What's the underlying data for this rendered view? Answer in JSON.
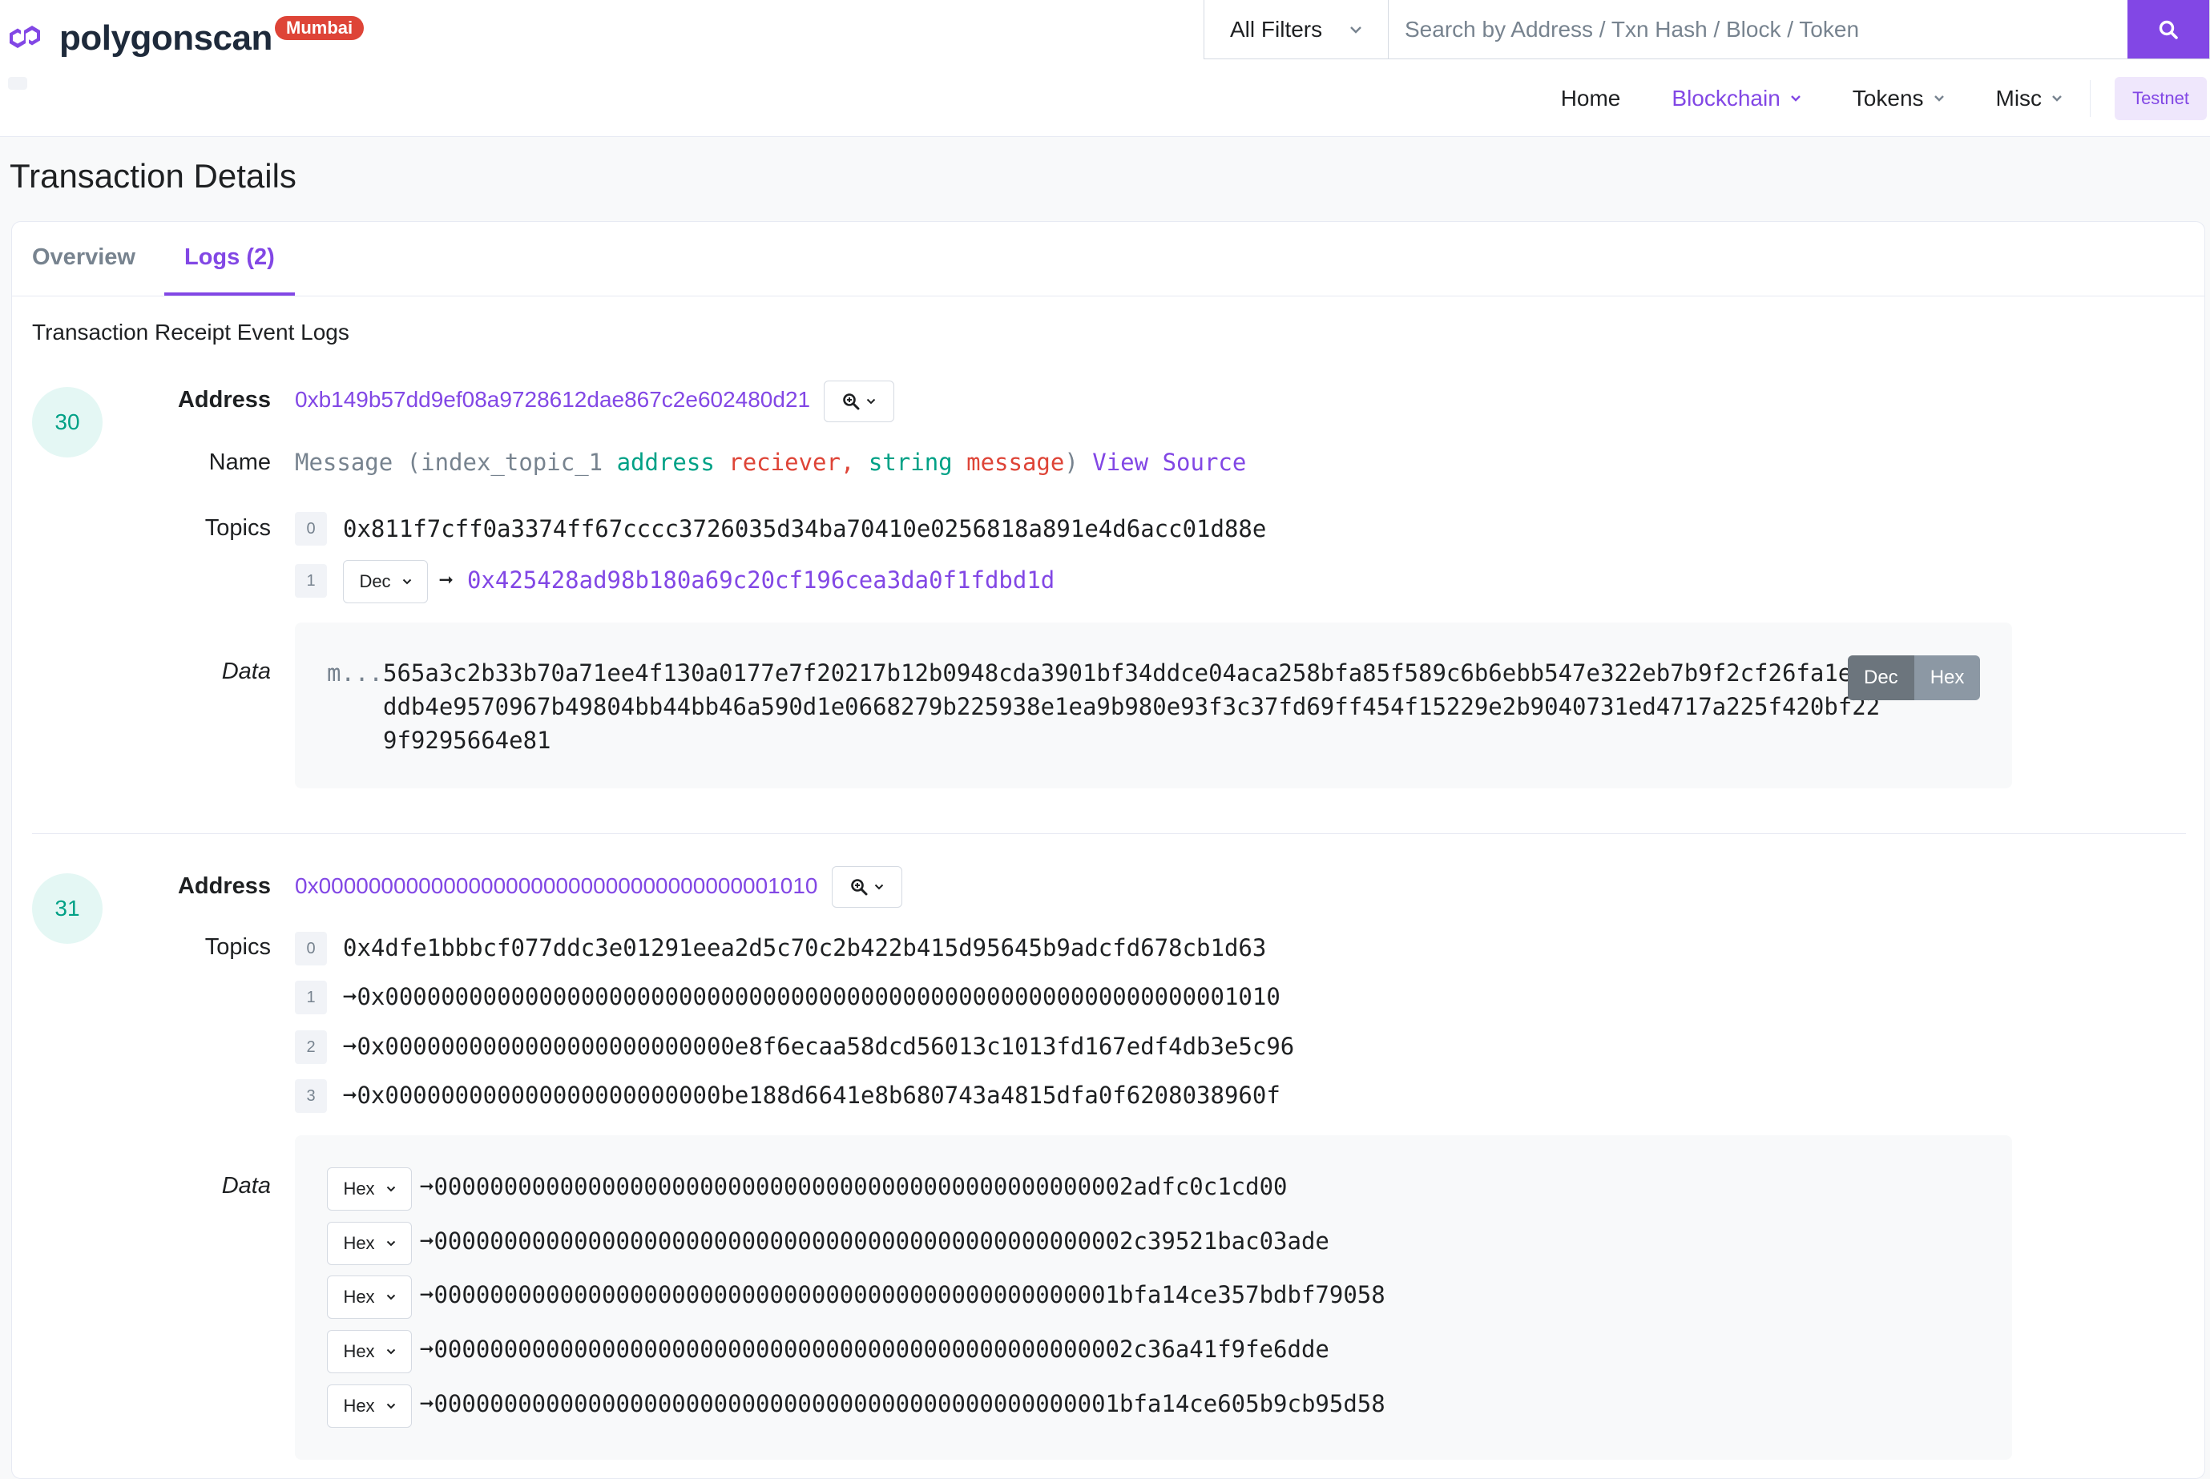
{
  "header": {
    "logo_text": "polygonscan",
    "network_badge": "Mumbai",
    "filter_label": "All Filters",
    "search_placeholder": "Search by Address / Txn Hash / Block / Token",
    "nav": [
      {
        "label": "Home"
      },
      {
        "label": "Blockchain"
      },
      {
        "label": "Tokens"
      },
      {
        "label": "Misc"
      }
    ],
    "testnet_label": "Testnet"
  },
  "page_title": "Transaction Details",
  "tabs": [
    {
      "label": "Overview"
    },
    {
      "label": "Logs (2)"
    }
  ],
  "section_title": "Transaction Receipt Event Logs",
  "labels": {
    "address": "Address",
    "name": "Name",
    "topics": "Topics",
    "data": "Data"
  },
  "logs": [
    {
      "index": "30",
      "address": "0xb149b57dd9ef08a9728612dae867c2e602480d21",
      "name": {
        "event": "Message (index_topic_1",
        "type1": "address",
        "param1": "reciever,",
        "type2": "string",
        "param2": "message",
        "close": ")",
        "view_source": "View Source"
      },
      "topics": [
        {
          "idx": "0",
          "value": "0x811f7cff0a3374ff67cccc3726035d34ba70410e0256818a891e4d6acc01d88e"
        },
        {
          "idx": "1",
          "format": "Dec",
          "value": "0x425428ad98b180a69c20cf196cea3da0f1fdbd1d"
        }
      ],
      "data_prefix": "m...",
      "data_lines": [
        "565a3c2b33b70a71ee4f130a0177e7f20217b12b0948cda3901bf34ddce04aca258bfa85f589c6b6ebb547e322eb7b9f2cf26fa1e32",
        "ddb4e9570967b49804bb44bb46a590d1e0668279b225938e1ea9b980e93f3c37fd69ff454f15229e2b9040731ed4717a225f420bf22",
        "9f9295664e81"
      ],
      "toggle": {
        "dec": "Dec",
        "hex": "Hex"
      }
    },
    {
      "index": "31",
      "address": "0x0000000000000000000000000000000000001010",
      "topics": [
        {
          "idx": "0",
          "value": "0x4dfe1bbbcf077ddc3e01291eea2d5c70c2b422b415d95645b9adcfd678cb1d63"
        },
        {
          "idx": "1",
          "value": "0x0000000000000000000000000000000000000000000000000000000000001010"
        },
        {
          "idx": "2",
          "value": "0x0000000000000000000000000e8f6ecaa58dcd56013c1013fd167edf4db3e5c96"
        },
        {
          "idx": "3",
          "value": "0x000000000000000000000000be188d6641e8b680743a4815dfa0f6208038960f"
        }
      ],
      "data_rows": [
        {
          "format": "Hex",
          "value": "00000000000000000000000000000000000000000000000002adfc0c1cd00"
        },
        {
          "format": "Hex",
          "value": "00000000000000000000000000000000000000000000000002c39521bac03ade"
        },
        {
          "format": "Hex",
          "value": "0000000000000000000000000000000000000000000000001bfa14ce357bdbf79058"
        },
        {
          "format": "Hex",
          "value": "00000000000000000000000000000000000000000000000002c36a41f9fe6dde"
        },
        {
          "format": "Hex",
          "value": "0000000000000000000000000000000000000000000000001bfa14ce605b9cb95d58"
        }
      ]
    }
  ]
}
